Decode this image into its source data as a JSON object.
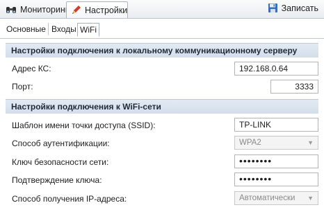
{
  "toolbar": {
    "monitoring_label": "Мониторинг",
    "settings_label": "Настройки",
    "save_label": "Записать",
    "icons": {
      "monitoring": "binoculars-icon",
      "settings": "pencil-icon",
      "save": "floppy-disk-icon"
    }
  },
  "subtabs": {
    "basic": "Основные",
    "inputs": "Входы",
    "wifi": "WiFi"
  },
  "sections": {
    "server": {
      "title": "Настройки подключения к локальному коммуникационному серверу",
      "address_label": "Адрес КС:",
      "address_value": "192.168.0.64",
      "port_label": "Порт:",
      "port_value": "3333"
    },
    "wifi": {
      "title": "Настройки подключения к WiFi-сети",
      "ssid_label": "Шаблон имени точки доступа (SSID):",
      "ssid_value": "TP-LINK",
      "auth_label": "Способ аутентификации:",
      "auth_value": "WPA2",
      "key_label": "Ключ безопасности сети:",
      "key_value": "••••••••",
      "confirm_label": "Подтверждение ключа:",
      "confirm_value": "••••••••",
      "ip_label": "Способ получения IP-адреса:",
      "ip_value": "Автоматически"
    }
  },
  "colors": {
    "section_bar": "#d9e4ef",
    "save_icon": "#3b6fb5",
    "pencil_icon": "#d23b2f"
  }
}
